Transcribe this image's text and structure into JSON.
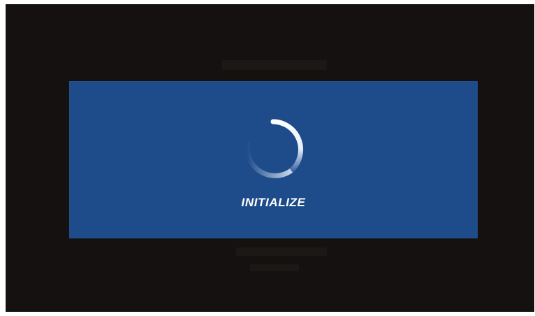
{
  "dialog": {
    "status_text": "INITIALIZE",
    "spinner_icon": "loading-spinner-icon"
  },
  "colors": {
    "screen_background": "#141110",
    "dialog_background": "#1e4c8a",
    "text": "#ffffff"
  }
}
